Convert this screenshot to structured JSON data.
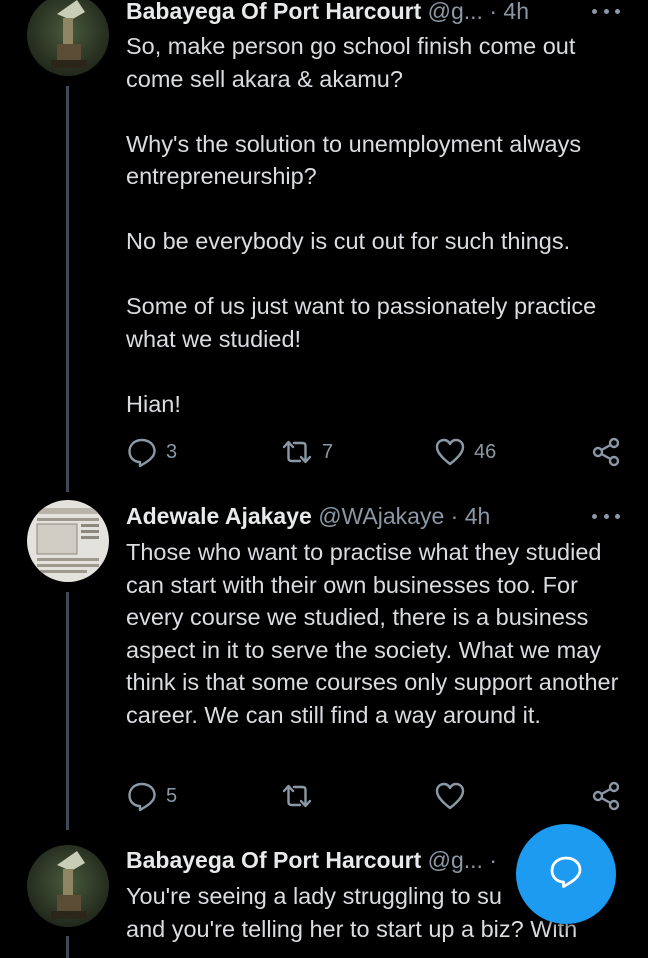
{
  "tweets": [
    {
      "name": "Babayega Of Port Harcourt",
      "handle": "@g...",
      "dot": "·",
      "time": "4h",
      "paragraphs": [
        "So, make person go school finish come out come sell akara & akamu?",
        "Why's the solution to unemployment always entrepreneurship?",
        "No be everybody is cut out for such things.",
        "Some of us just want to passionately practice what we studied!",
        "Hian!"
      ],
      "replies": "3",
      "retweets": "7",
      "likes": "46"
    },
    {
      "name": "Adewale Ajakaye",
      "handle": "@WAjakaye",
      "dot": "·",
      "time": "4h",
      "paragraphs": [
        "Those who want to practise what they studied can start with their own businesses too. For every course we studied, there is a business aspect in it to serve the society. What we may think is that some courses only support another career. We can still find a way around it."
      ],
      "replies": "5",
      "retweets": "",
      "likes": ""
    },
    {
      "name": "Babayega Of Port Harcourt",
      "handle": "@g...",
      "dot": "·",
      "paragraphs": [
        "You're seeing a lady struggling to su",
        "and you're telling her to start up a biz? With"
      ]
    }
  ],
  "icons": {
    "reply": "reply-icon",
    "retweet": "retweet-icon",
    "like": "heart-icon",
    "share": "share-icon",
    "more": "more-icon",
    "compose": "compose-icon"
  },
  "colors": {
    "background": "#000000",
    "text": "#dadce0",
    "muted": "#8b98a5",
    "accent": "#1d9bf0",
    "thread_line": "#3d4a55"
  }
}
